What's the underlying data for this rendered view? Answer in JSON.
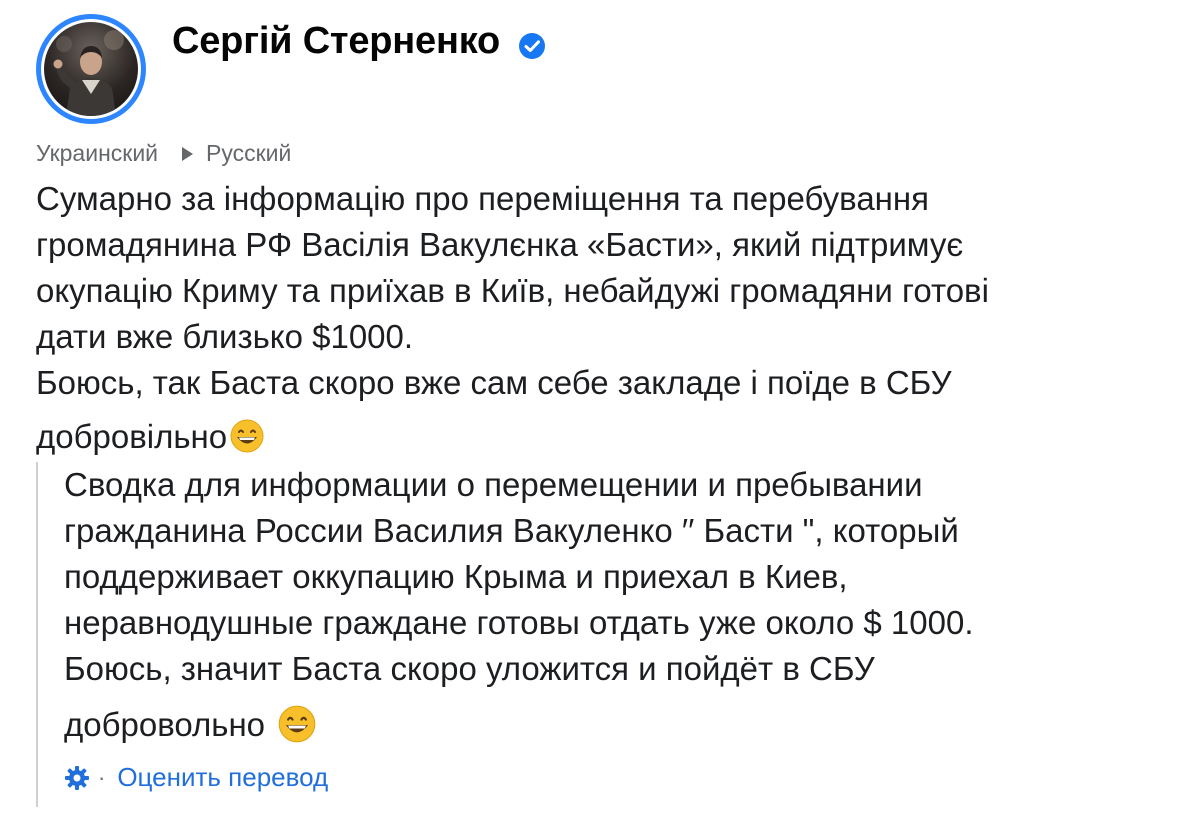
{
  "author": {
    "name": "Сергій Стерненко",
    "verified": true
  },
  "colors": {
    "avatar_ring": "#2d86ff",
    "verified_badge": "#1877f2",
    "link": "#216fdb",
    "muted": "#65676b",
    "divider": "#ced0d4"
  },
  "translation": {
    "source_language": "Украинский",
    "target_language": "Русский",
    "rate_label": "Оценить перевод",
    "separator": "·",
    "icons": [
      "triangle-right-icon",
      "gear-icon"
    ]
  },
  "post": {
    "original_lines": [
      "Сумарно за інформацію про переміщення та перебування",
      "громадянина РФ Васілія Вакулєнка «Басти», який підтримує",
      "окупацію Криму та приїхав в Київ, небайдужі громадяни готові",
      "дати вже близько $1000.",
      "Боюсь, так Баста скоро вже сам себе закладе і поїде в СБУ",
      "добровільно"
    ],
    "translated_lines": [
      "Сводка для информации о перемещении и пребывании",
      "гражданина России Василия Вакуленко ′′ Басти \", который",
      "поддерживает оккупацию Крыма и приехал в Киев,",
      "неравнодушные граждане готовы отдать уже около $ 1000.",
      "Боюсь, значит Баста скоро уложится и пойдёт в СБУ",
      "добровольно"
    ],
    "emoji": "grinning-face-emoji"
  }
}
